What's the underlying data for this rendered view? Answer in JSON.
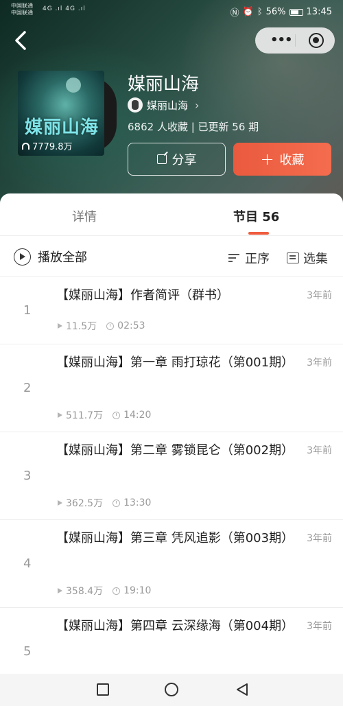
{
  "status_bar": {
    "carrier_line1": "中国联通",
    "carrier_line2": "中国联通",
    "signal_text": "4G .ıl  4G .ıl",
    "icons": [
      "nfc-icon",
      "alarm-icon",
      "bluetooth-icon"
    ],
    "battery": "56%",
    "time": "13:45"
  },
  "nav": {
    "back_icon": "chevron-left-icon",
    "capsule_more_icon": "more-dots-icon",
    "capsule_close_icon": "target-close-icon"
  },
  "album": {
    "cover_title": "媒丽山海",
    "play_count": "7779.8万",
    "title": "媒丽山海",
    "anchor_name": "媒丽山海",
    "stats": "6862 人收藏 | 已更新 56 期",
    "share_label": "分享",
    "collect_label": "收藏"
  },
  "tabs": {
    "detail": "详情",
    "programs": "节目 56"
  },
  "toolbar": {
    "play_all": "播放全部",
    "sort": "正序",
    "select": "选集"
  },
  "episodes": [
    {
      "no": "1",
      "title": "【媒丽山海】作者简评（群书）",
      "date": "3年前",
      "plays": "11.5万",
      "duration": "02:53"
    },
    {
      "no": "2",
      "title": "【媒丽山海】第一章 雨打琼花（第001期）",
      "date": "3年前",
      "plays": "511.7万",
      "duration": "14:20"
    },
    {
      "no": "3",
      "title": "【媒丽山海】第二章 雾锁昆仑（第002期）",
      "date": "3年前",
      "plays": "362.5万",
      "duration": "13:30"
    },
    {
      "no": "4",
      "title": "【媒丽山海】第三章 凭风追影（第003期）",
      "date": "3年前",
      "plays": "358.4万",
      "duration": "19:10"
    },
    {
      "no": "5",
      "title": "【媒丽山海】第四章 云深缘海（第004期）",
      "date": "3年前",
      "plays": "",
      "duration": ""
    }
  ],
  "colors": {
    "accent": "#ef5d3f",
    "header_bg": "#2e4d45"
  }
}
